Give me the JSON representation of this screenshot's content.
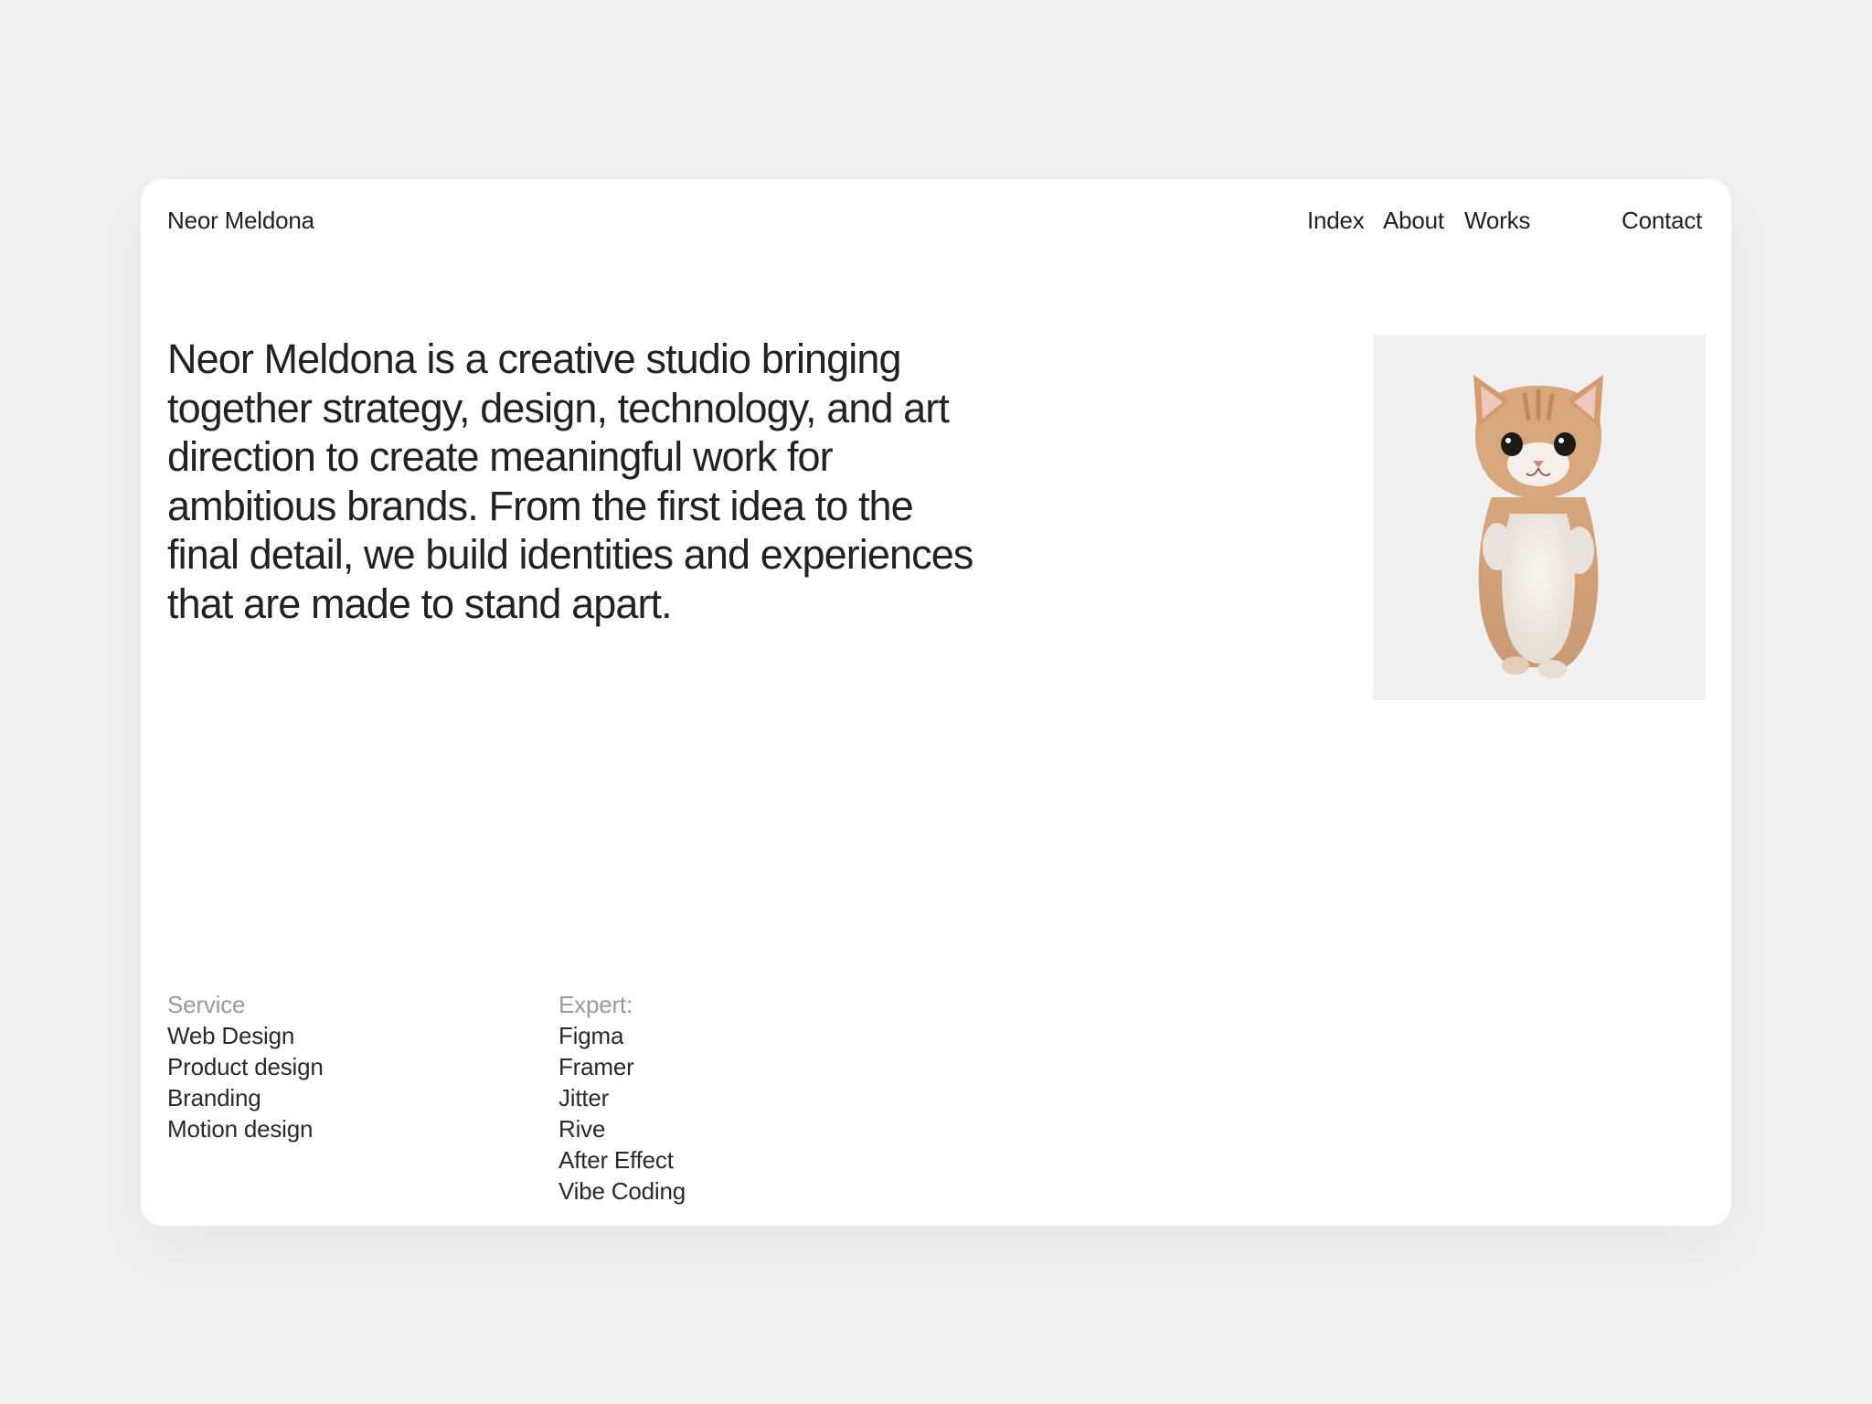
{
  "brand": "Neor Meldona",
  "nav": {
    "index": "Index",
    "about": "About",
    "works": "Works",
    "contact": "Contact"
  },
  "intro": "Neor Meldona is a creative studio bringing together strategy, design, technology, and art direction to create meaningful work for ambitious brands. From the first idea to the final detail, we build identities and experiences that are made to stand apart.",
  "services": {
    "heading": "Service",
    "items": [
      "Web Design",
      "Product design",
      "Branding",
      "Motion design"
    ]
  },
  "expert": {
    "heading": "Expert:",
    "items": [
      "Figma",
      "Framer",
      "Jitter",
      "Rive",
      "After Effect",
      "Vibe Coding"
    ]
  },
  "colors": {
    "page_background": "#efefef",
    "card_background": "#ffffff",
    "text": "#222222",
    "muted_text": "#9a9a9a",
    "image_background": "#f0f0f0"
  },
  "icons": [
    "kitten-image"
  ]
}
